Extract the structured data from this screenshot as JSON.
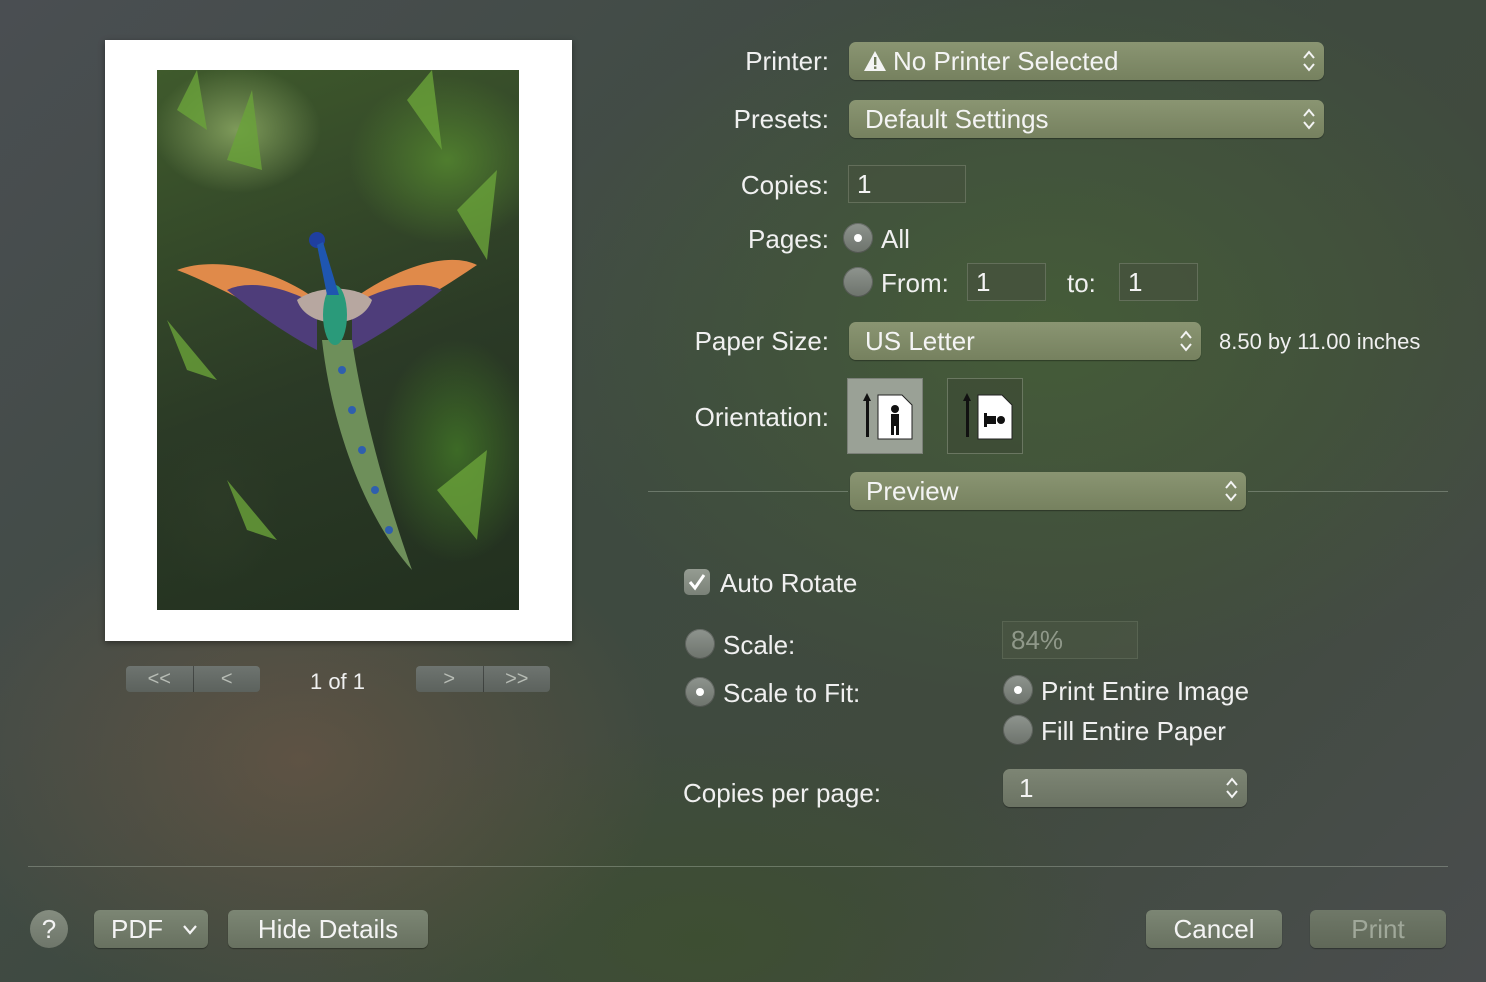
{
  "preview": {
    "page_indicator": "1 of 1",
    "nav_first": "<<",
    "nav_prev": "<",
    "nav_next": ">",
    "nav_last": ">>"
  },
  "printer": {
    "label": "Printer:",
    "value": "No Printer Selected",
    "warning_icon": "warning-triangle-icon"
  },
  "presets": {
    "label": "Presets:",
    "value": "Default Settings"
  },
  "copies": {
    "label": "Copies:",
    "value": "1"
  },
  "pages": {
    "label": "Pages:",
    "all_label": "All",
    "from_label": "From:",
    "from_value": "1",
    "to_label": "to:",
    "to_value": "1",
    "selected": "All"
  },
  "paper_size": {
    "label": "Paper Size:",
    "value": "US Letter",
    "dimensions": "8.50 by 11.00 inches"
  },
  "orientation": {
    "label": "Orientation:",
    "selected": "portrait"
  },
  "section_popup": {
    "value": "Preview"
  },
  "preview_options": {
    "auto_rotate_label": "Auto Rotate",
    "auto_rotate_checked": true,
    "scale_label": "Scale:",
    "scale_value": "84%",
    "scale_to_fit_label": "Scale to Fit:",
    "print_entire_image_label": "Print Entire Image",
    "fill_entire_paper_label": "Fill Entire Paper",
    "fit_selected": "Print Entire Image",
    "copies_per_page_label": "Copies per page:",
    "copies_per_page_value": "1"
  },
  "footer": {
    "help_label": "?",
    "pdf_label": "PDF",
    "hide_details_label": "Hide Details",
    "cancel_label": "Cancel",
    "print_label": "Print"
  },
  "colors": {
    "popup": "#808b69",
    "page": "#ffffff"
  }
}
